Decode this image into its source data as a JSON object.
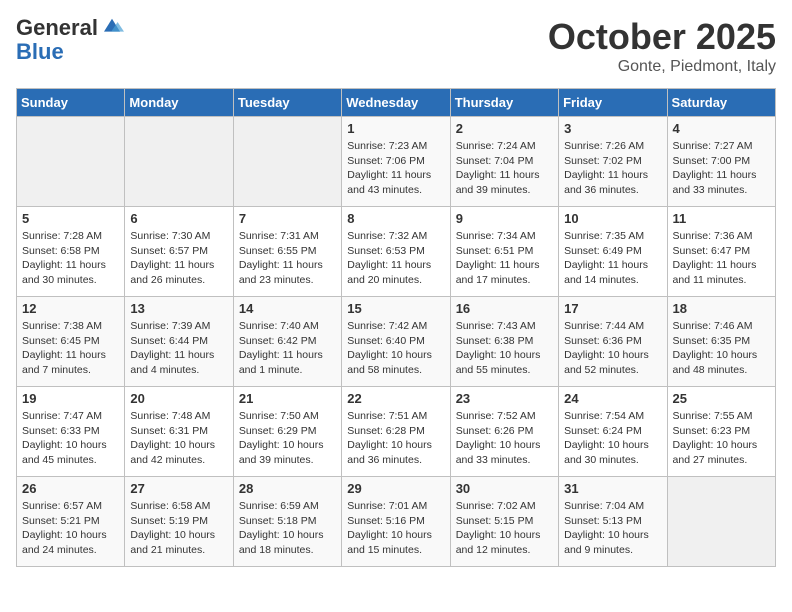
{
  "header": {
    "logo_general": "General",
    "logo_blue": "Blue",
    "month_title": "October 2025",
    "location": "Gonte, Piedmont, Italy"
  },
  "days_of_week": [
    "Sunday",
    "Monday",
    "Tuesday",
    "Wednesday",
    "Thursday",
    "Friday",
    "Saturday"
  ],
  "weeks": [
    [
      {
        "day": "",
        "info": ""
      },
      {
        "day": "",
        "info": ""
      },
      {
        "day": "",
        "info": ""
      },
      {
        "day": "1",
        "info": "Sunrise: 7:23 AM\nSunset: 7:06 PM\nDaylight: 11 hours\nand 43 minutes."
      },
      {
        "day": "2",
        "info": "Sunrise: 7:24 AM\nSunset: 7:04 PM\nDaylight: 11 hours\nand 39 minutes."
      },
      {
        "day": "3",
        "info": "Sunrise: 7:26 AM\nSunset: 7:02 PM\nDaylight: 11 hours\nand 36 minutes."
      },
      {
        "day": "4",
        "info": "Sunrise: 7:27 AM\nSunset: 7:00 PM\nDaylight: 11 hours\nand 33 minutes."
      }
    ],
    [
      {
        "day": "5",
        "info": "Sunrise: 7:28 AM\nSunset: 6:58 PM\nDaylight: 11 hours\nand 30 minutes."
      },
      {
        "day": "6",
        "info": "Sunrise: 7:30 AM\nSunset: 6:57 PM\nDaylight: 11 hours\nand 26 minutes."
      },
      {
        "day": "7",
        "info": "Sunrise: 7:31 AM\nSunset: 6:55 PM\nDaylight: 11 hours\nand 23 minutes."
      },
      {
        "day": "8",
        "info": "Sunrise: 7:32 AM\nSunset: 6:53 PM\nDaylight: 11 hours\nand 20 minutes."
      },
      {
        "day": "9",
        "info": "Sunrise: 7:34 AM\nSunset: 6:51 PM\nDaylight: 11 hours\nand 17 minutes."
      },
      {
        "day": "10",
        "info": "Sunrise: 7:35 AM\nSunset: 6:49 PM\nDaylight: 11 hours\nand 14 minutes."
      },
      {
        "day": "11",
        "info": "Sunrise: 7:36 AM\nSunset: 6:47 PM\nDaylight: 11 hours\nand 11 minutes."
      }
    ],
    [
      {
        "day": "12",
        "info": "Sunrise: 7:38 AM\nSunset: 6:45 PM\nDaylight: 11 hours\nand 7 minutes."
      },
      {
        "day": "13",
        "info": "Sunrise: 7:39 AM\nSunset: 6:44 PM\nDaylight: 11 hours\nand 4 minutes."
      },
      {
        "day": "14",
        "info": "Sunrise: 7:40 AM\nSunset: 6:42 PM\nDaylight: 11 hours\nand 1 minute."
      },
      {
        "day": "15",
        "info": "Sunrise: 7:42 AM\nSunset: 6:40 PM\nDaylight: 10 hours\nand 58 minutes."
      },
      {
        "day": "16",
        "info": "Sunrise: 7:43 AM\nSunset: 6:38 PM\nDaylight: 10 hours\nand 55 minutes."
      },
      {
        "day": "17",
        "info": "Sunrise: 7:44 AM\nSunset: 6:36 PM\nDaylight: 10 hours\nand 52 minutes."
      },
      {
        "day": "18",
        "info": "Sunrise: 7:46 AM\nSunset: 6:35 PM\nDaylight: 10 hours\nand 48 minutes."
      }
    ],
    [
      {
        "day": "19",
        "info": "Sunrise: 7:47 AM\nSunset: 6:33 PM\nDaylight: 10 hours\nand 45 minutes."
      },
      {
        "day": "20",
        "info": "Sunrise: 7:48 AM\nSunset: 6:31 PM\nDaylight: 10 hours\nand 42 minutes."
      },
      {
        "day": "21",
        "info": "Sunrise: 7:50 AM\nSunset: 6:29 PM\nDaylight: 10 hours\nand 39 minutes."
      },
      {
        "day": "22",
        "info": "Sunrise: 7:51 AM\nSunset: 6:28 PM\nDaylight: 10 hours\nand 36 minutes."
      },
      {
        "day": "23",
        "info": "Sunrise: 7:52 AM\nSunset: 6:26 PM\nDaylight: 10 hours\nand 33 minutes."
      },
      {
        "day": "24",
        "info": "Sunrise: 7:54 AM\nSunset: 6:24 PM\nDaylight: 10 hours\nand 30 minutes."
      },
      {
        "day": "25",
        "info": "Sunrise: 7:55 AM\nSunset: 6:23 PM\nDaylight: 10 hours\nand 27 minutes."
      }
    ],
    [
      {
        "day": "26",
        "info": "Sunrise: 6:57 AM\nSunset: 5:21 PM\nDaylight: 10 hours\nand 24 minutes."
      },
      {
        "day": "27",
        "info": "Sunrise: 6:58 AM\nSunset: 5:19 PM\nDaylight: 10 hours\nand 21 minutes."
      },
      {
        "day": "28",
        "info": "Sunrise: 6:59 AM\nSunset: 5:18 PM\nDaylight: 10 hours\nand 18 minutes."
      },
      {
        "day": "29",
        "info": "Sunrise: 7:01 AM\nSunset: 5:16 PM\nDaylight: 10 hours\nand 15 minutes."
      },
      {
        "day": "30",
        "info": "Sunrise: 7:02 AM\nSunset: 5:15 PM\nDaylight: 10 hours\nand 12 minutes."
      },
      {
        "day": "31",
        "info": "Sunrise: 7:04 AM\nSunset: 5:13 PM\nDaylight: 10 hours\nand 9 minutes."
      },
      {
        "day": "",
        "info": ""
      }
    ]
  ]
}
